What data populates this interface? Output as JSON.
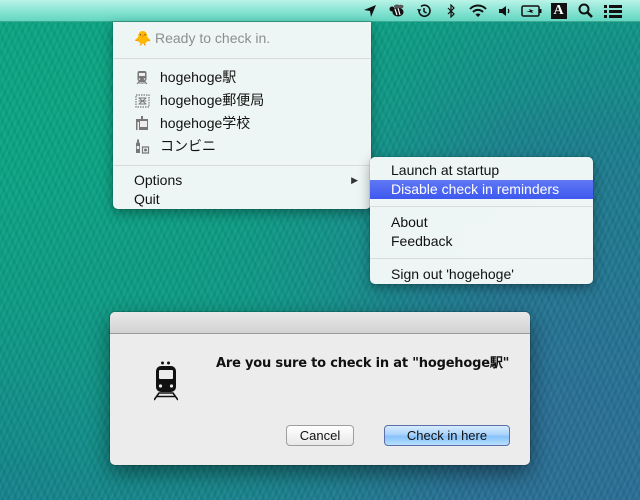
{
  "menubar": {
    "icons": [
      {
        "name": "location-arrow-icon"
      },
      {
        "name": "bee-app-icon"
      },
      {
        "name": "time-machine-icon"
      },
      {
        "name": "bluetooth-icon"
      },
      {
        "name": "wifi-icon"
      },
      {
        "name": "volume-icon"
      },
      {
        "name": "battery-charging-icon"
      },
      {
        "name": "input-source-icon",
        "label": "A"
      },
      {
        "name": "spotlight-search-icon"
      },
      {
        "name": "notification-center-icon"
      }
    ]
  },
  "main_menu": {
    "status": {
      "emoji": "🐥",
      "label": "Ready to check in."
    },
    "places": [
      {
        "icon": "train-icon",
        "label": "hogehoge駅"
      },
      {
        "icon": "post-office-icon",
        "label": "hogehoge郵便局"
      },
      {
        "icon": "school-icon",
        "label": "hogehoge学校"
      },
      {
        "icon": "convenience-store-icon",
        "label": "コンビニ"
      }
    ],
    "options_label": "Options",
    "options_arrow": "▶",
    "quit_label": "Quit"
  },
  "sub_menu": {
    "launch_at_startup": "Launch at startup",
    "disable_reminders": "Disable check in reminders",
    "about": "About",
    "feedback": "Feedback",
    "sign_out": "Sign out 'hogehoge'"
  },
  "dialog": {
    "message": "Are you sure to check in at \"hogehoge駅\"",
    "cancel_label": "Cancel",
    "confirm_label": "Check in here"
  },
  "colors": {
    "highlight": "#3e58ef",
    "default_button": "#86c2fa"
  }
}
